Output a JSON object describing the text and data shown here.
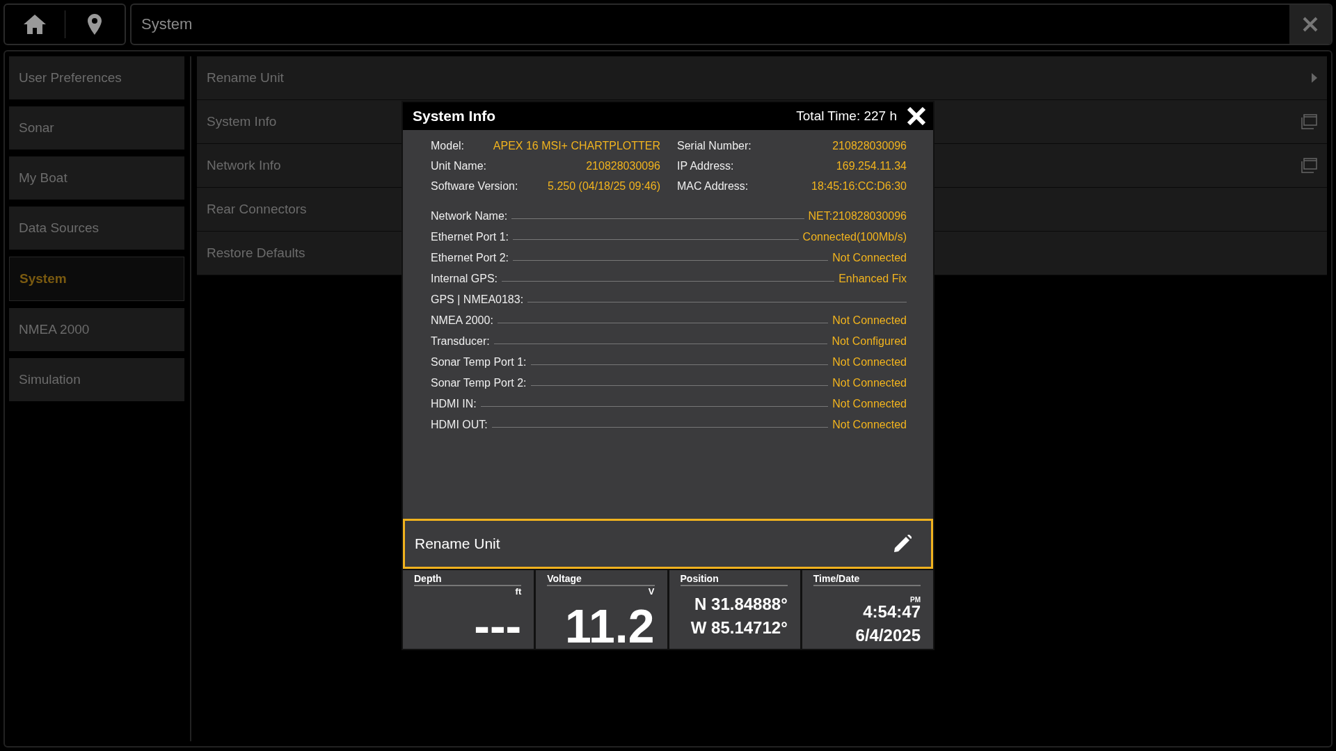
{
  "top_bar": {
    "title": "System"
  },
  "sidebar": {
    "items": [
      {
        "label": "User Preferences",
        "selected": false
      },
      {
        "label": "Sonar",
        "selected": false
      },
      {
        "label": "My Boat",
        "selected": false
      },
      {
        "label": "Data Sources",
        "selected": false
      },
      {
        "label": "System",
        "selected": true
      },
      {
        "label": "NMEA 2000",
        "selected": false
      },
      {
        "label": "Simulation",
        "selected": false
      }
    ]
  },
  "menu": {
    "items": [
      {
        "label": "Rename Unit",
        "kind": "submenu"
      },
      {
        "label": "System Info",
        "kind": "popup"
      },
      {
        "label": "Network Info",
        "kind": "popup"
      },
      {
        "label": "Rear Connectors",
        "kind": "plain"
      },
      {
        "label": "Restore Defaults",
        "kind": "plain"
      }
    ]
  },
  "dialog": {
    "title": "System Info",
    "total_time": "Total Time: 227 h",
    "info_left": [
      {
        "label": "Model:",
        "value": "APEX 16 MSI+ CHARTPLOTTER"
      },
      {
        "label": "Unit Name:",
        "value": "210828030096"
      },
      {
        "label": "Software Version:",
        "value": "5.250 (04/18/25 09:46)"
      }
    ],
    "info_right": [
      {
        "label": "Serial Number:",
        "value": "210828030096"
      },
      {
        "label": "IP Address:",
        "value": "169.254.11.34"
      },
      {
        "label": "MAC Address:",
        "value": "18:45:16:CC:D6:30"
      }
    ],
    "status_rows": [
      {
        "label": "Network Name:",
        "value": "NET:210828030096"
      },
      {
        "label": "Ethernet Port 1:",
        "value": "Connected(100Mb/s)"
      },
      {
        "label": "Ethernet Port 2:",
        "value": "Not Connected"
      },
      {
        "label": "Internal GPS:",
        "value": "Enhanced Fix"
      },
      {
        "label": "GPS | NMEA0183:"
      },
      {
        "label": "NMEA 2000:",
        "value": "Not Connected"
      },
      {
        "label": "Transducer:",
        "value": "Not Configured"
      },
      {
        "label": "Sonar Temp Port 1:",
        "value": "Not Connected"
      },
      {
        "label": "Sonar Temp Port 2:",
        "value": "Not Connected"
      },
      {
        "label": "HDMI IN:",
        "value": "Not Connected"
      },
      {
        "label": "HDMI OUT:",
        "value": "Not Connected"
      }
    ],
    "action": {
      "label": "Rename Unit",
      "selected": true
    }
  },
  "gauges": [
    {
      "kind": "big",
      "title": "Depth",
      "unit": "ft",
      "value": "---"
    },
    {
      "kind": "big",
      "title": "Voltage",
      "unit": "V",
      "value": "11.2"
    },
    {
      "kind": "lines",
      "title": "Position",
      "lines": [
        "N 31.84888°",
        "W 85.14712°"
      ]
    },
    {
      "kind": "time",
      "title": "Time/Date",
      "ampm": "PM",
      "time": "4:54:47",
      "date": "6/4/2025"
    }
  ]
}
